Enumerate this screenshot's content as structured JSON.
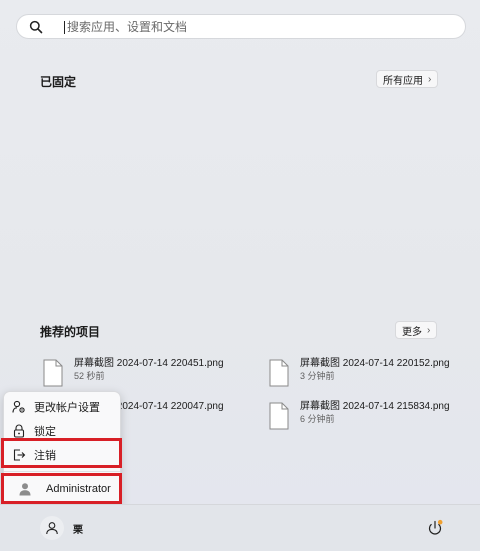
{
  "search": {
    "placeholder": "搜索应用、设置和文档",
    "value": ""
  },
  "pinned": {
    "title": "已固定",
    "all_apps_label": "所有应用"
  },
  "recommended": {
    "title": "推荐的项目",
    "more_label": "更多",
    "items": [
      {
        "name": "屏幕截图 2024-07-14 220451.png",
        "time": "52 秒前"
      },
      {
        "name": "屏幕截图 2024-07-14 220152.png",
        "time": "3 分钟前"
      },
      {
        "name": "屏幕截图 2024-07-14 220047.png",
        "time": ""
      },
      {
        "name": "屏幕截图 2024-07-14 215834.png",
        "time": "6 分钟前"
      }
    ]
  },
  "account_menu": {
    "change_settings_label": "更改帐户设置",
    "lock_label": "锁定",
    "sign_out_label": "注销",
    "other_user_label": "Administrator"
  },
  "taskbar": {
    "user_name": "栗"
  },
  "colors": {
    "highlight": "#d81f26",
    "update_dot": "#f0a030"
  }
}
